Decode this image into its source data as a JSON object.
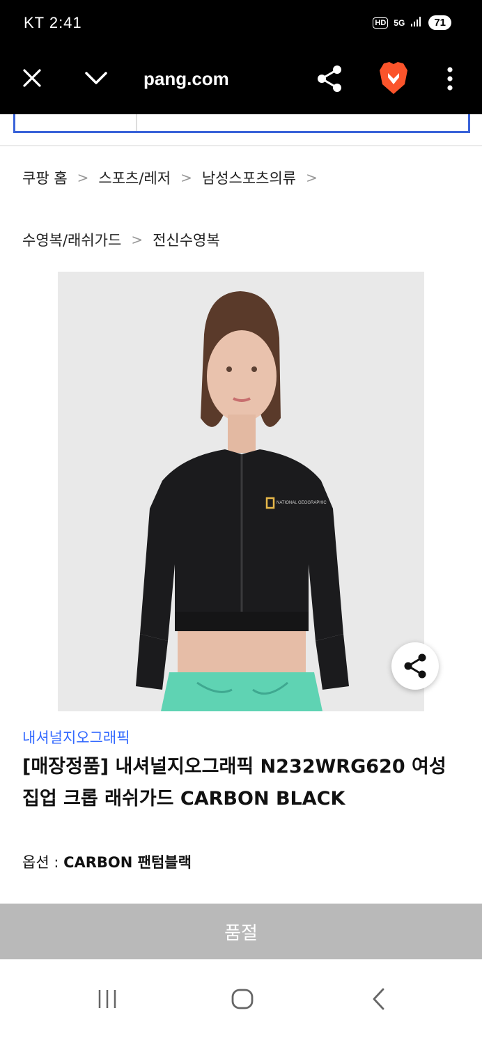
{
  "status_bar": {
    "carrier_time": "KT 2:41",
    "hd_badge": "HD",
    "network": "5G",
    "battery": "71",
    "icons": [
      "hd-voice-icon",
      "5g-icon",
      "signal-icon",
      "battery-icon"
    ]
  },
  "browser": {
    "url": "pang.com",
    "icons": [
      "close-icon",
      "chevron-down-icon",
      "share-icon",
      "brave-lion-icon",
      "more-vert-icon"
    ],
    "brand_color": "#fb542b"
  },
  "breadcrumb": {
    "line1": [
      "쿠팡 홈",
      "스포츠/레저",
      "남성스포츠의류"
    ],
    "line2": [
      "수영복/래쉬가드",
      "전신수영복"
    ]
  },
  "product": {
    "image_logo_text": "NATIONAL GEOGRAPHIC",
    "brand": "내셔널지오그래픽",
    "title": "[매장정품] 내셔널지오그래픽 N232WRG620 여성 집업 크롭 래쉬가드 CARBON BLACK",
    "option_label": "옵션 : ",
    "option_value": "CARBON 팬텀블랙",
    "soldout_label": "품절"
  },
  "colors": {
    "accent_blue": "#346aff",
    "search_border": "#3a63d9",
    "soldout_bg": "#b9b9b9"
  },
  "nav_bar": {
    "icons": [
      "recent-apps-icon",
      "home-icon",
      "back-icon"
    ]
  }
}
